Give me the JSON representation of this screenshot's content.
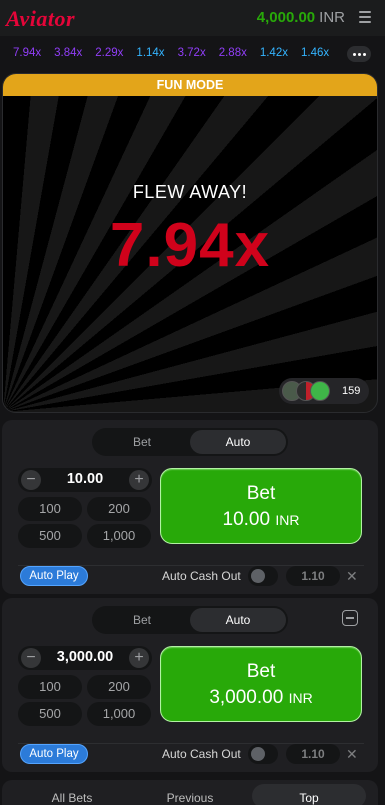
{
  "header": {
    "logo": "Aviator",
    "balance": "4,000.00",
    "currency": "INR"
  },
  "history": [
    {
      "value": "7.94x",
      "color": "#913ef8"
    },
    {
      "value": "3.84x",
      "color": "#913ef8"
    },
    {
      "value": "2.29x",
      "color": "#913ef8"
    },
    {
      "value": "1.14x",
      "color": "#34b4ff"
    },
    {
      "value": "3.72x",
      "color": "#913ef8"
    },
    {
      "value": "2.88x",
      "color": "#913ef8"
    },
    {
      "value": "1.42x",
      "color": "#34b4ff"
    },
    {
      "value": "1.46x",
      "color": "#34b4ff"
    }
  ],
  "game": {
    "banner": "FUN MODE",
    "status": "FLEW AWAY!",
    "multiplier": "7.94x",
    "players": "159"
  },
  "panels": [
    {
      "tabs": [
        "Bet",
        "Auto"
      ],
      "active_tab": "Auto",
      "amount": "10.00",
      "quick": [
        "100",
        "200",
        "500",
        "1,000"
      ],
      "bet_label": "Bet",
      "bet_amount": "10.00",
      "bet_currency": "INR",
      "autoplay": "Auto Play",
      "autocash": "Auto Cash Out",
      "cashout_value": "1.10"
    },
    {
      "tabs": [
        "Bet",
        "Auto"
      ],
      "active_tab": "Auto",
      "amount": "3,000.00",
      "quick": [
        "100",
        "200",
        "500",
        "1,000"
      ],
      "bet_label": "Bet",
      "bet_amount": "3,000.00",
      "bet_currency": "INR",
      "autoplay": "Auto Play",
      "autocash": "Auto Cash Out",
      "cashout_value": "1.10"
    }
  ],
  "bets_tabs": {
    "all": "All Bets",
    "previous": "Previous",
    "top": "Top"
  },
  "colors": {
    "brand_red": "#e50539",
    "win_green": "#28a909",
    "fun_mode_gold": "#e3a51a",
    "autoplay_blue": "#2c7bd9"
  }
}
